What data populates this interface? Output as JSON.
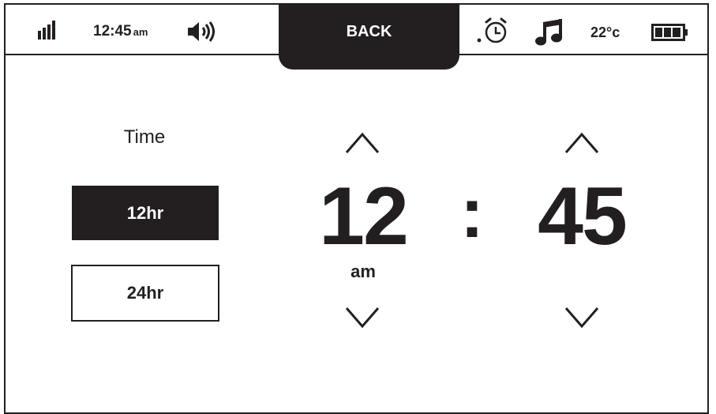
{
  "status_bar": {
    "time": "12:45",
    "time_period": "am",
    "temperature": "22°c",
    "back_label": "BACK",
    "icons": [
      "signal-icon",
      "speaker-icon",
      "alarm-icon",
      "music-icon",
      "battery-icon"
    ]
  },
  "format": {
    "label": "Time",
    "options": [
      "12hr",
      "24hr"
    ],
    "selected": "12hr"
  },
  "picker": {
    "hour": "12",
    "separator": ":",
    "minute": "45",
    "meridiem": "am"
  },
  "colors": {
    "foreground": "#231f20",
    "background": "#ffffff"
  }
}
